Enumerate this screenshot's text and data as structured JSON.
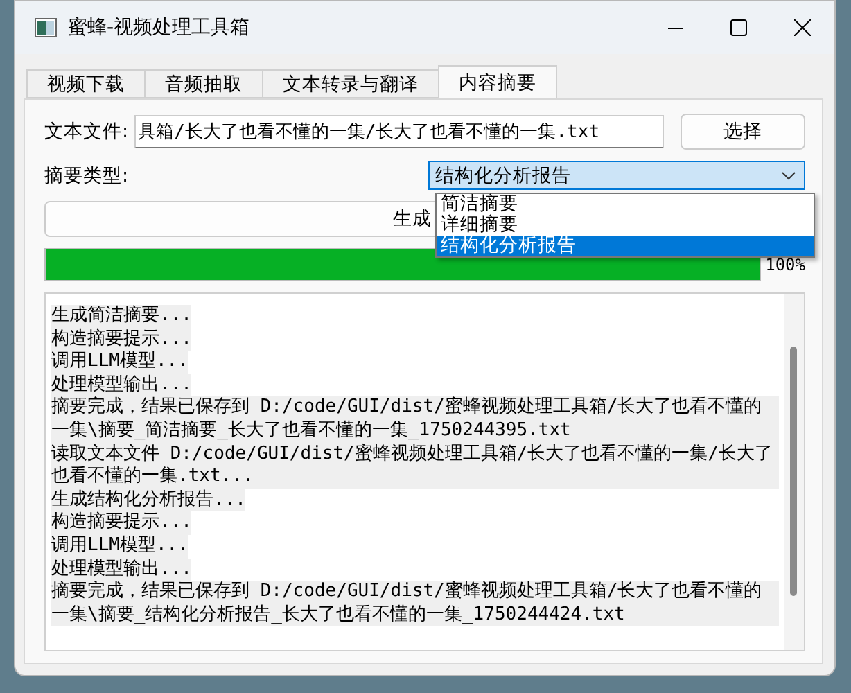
{
  "window": {
    "title": "蜜蜂-视频处理工具箱"
  },
  "tabs": [
    {
      "label": "视频下载",
      "selected": false
    },
    {
      "label": "音频抽取",
      "selected": false
    },
    {
      "label": "文本转录与翻译",
      "selected": false
    },
    {
      "label": "内容摘要",
      "selected": true
    }
  ],
  "file": {
    "label": "文本文件:",
    "value": "具箱/长大了也看不懂的一集/长大了也看不懂的一集.txt",
    "button": "选择"
  },
  "summary_type": {
    "label": "摘要类型:",
    "value": "结构化分析报告",
    "options": [
      {
        "label": "简洁摘要",
        "selected": false
      },
      {
        "label": "详细摘要",
        "selected": false
      },
      {
        "label": "结构化分析报告",
        "selected": true
      }
    ]
  },
  "generate_button": "生成",
  "progress": {
    "level": 1,
    "reading": "100%"
  },
  "log": [
    "生成简洁摘要...",
    "构造摘要提示...",
    "调用LLM模型...",
    "处理模型输出...",
    "摘要完成，结果已保存到 D:/code/GUI/dist/蜜蜂视频处理工具箱/长大了也看不懂的一集\\摘要_简洁摘要_长大了也看不懂的一集_1750244395.txt",
    "读取文本文件 D:/code/GUI/dist/蜜蜂视频处理工具箱/长大了也看不懂的一集/长大了也看不懂的一集.txt...",
    "生成结构化分析报告...",
    "构造摘要提示...",
    "调用LLM模型...",
    "处理模型输出...",
    "摘要完成，结果已保存到 D:/code/GUI/dist/蜜蜂视频处理工具箱/长大了也看不懂的一集\\摘要_结构化分析报告_长大了也看不懂的一集_1750244424.txt"
  ]
}
